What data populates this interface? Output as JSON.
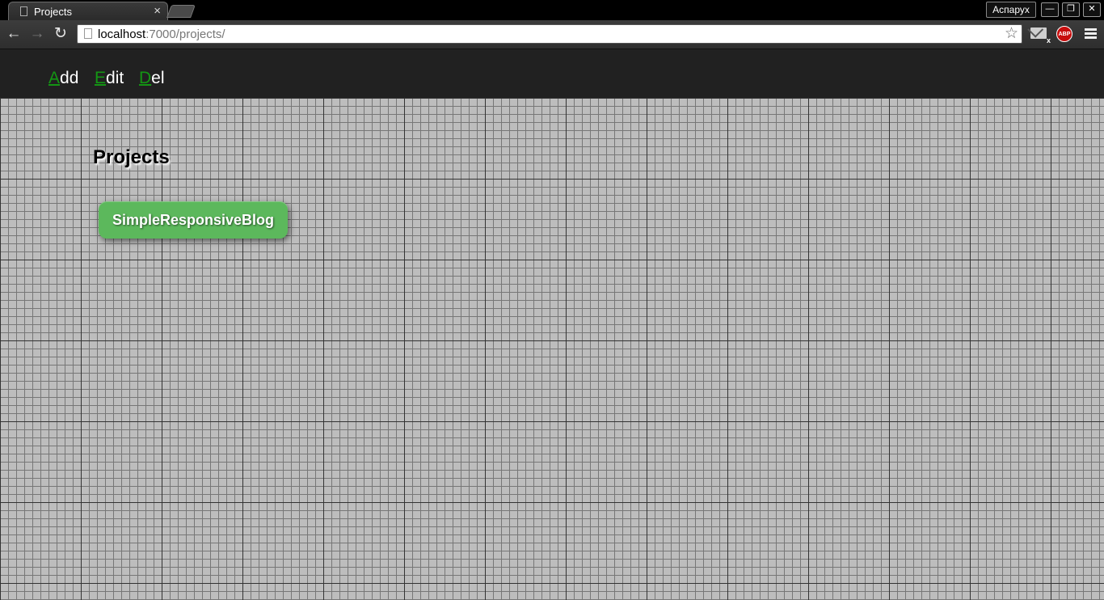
{
  "browser": {
    "tab_title": "Projects",
    "tab_close": "×",
    "profile_name": "Аспарух",
    "window_buttons": {
      "minimize": "—",
      "restore": "❐",
      "close": "✕"
    },
    "nav": {
      "back": "←",
      "forward": "→",
      "reload": "↻"
    },
    "url_host": "localhost",
    "url_path": ":7000/projects/",
    "bookmark_star": "☆",
    "mail_badge": "x",
    "abp_label": "ABP"
  },
  "app_nav": {
    "items": [
      {
        "hot": "A",
        "rest": "dd"
      },
      {
        "hot": "E",
        "rest": "dit"
      },
      {
        "hot": "D",
        "rest": "el"
      }
    ]
  },
  "main": {
    "title": "Projects",
    "projects": [
      "SimpleResponsiveBlog"
    ]
  },
  "colors": {
    "nav_background": "#212121",
    "hotkey_green": "#149614",
    "card_green": "#5cb85c",
    "grid_background": "#bdbdbd"
  }
}
